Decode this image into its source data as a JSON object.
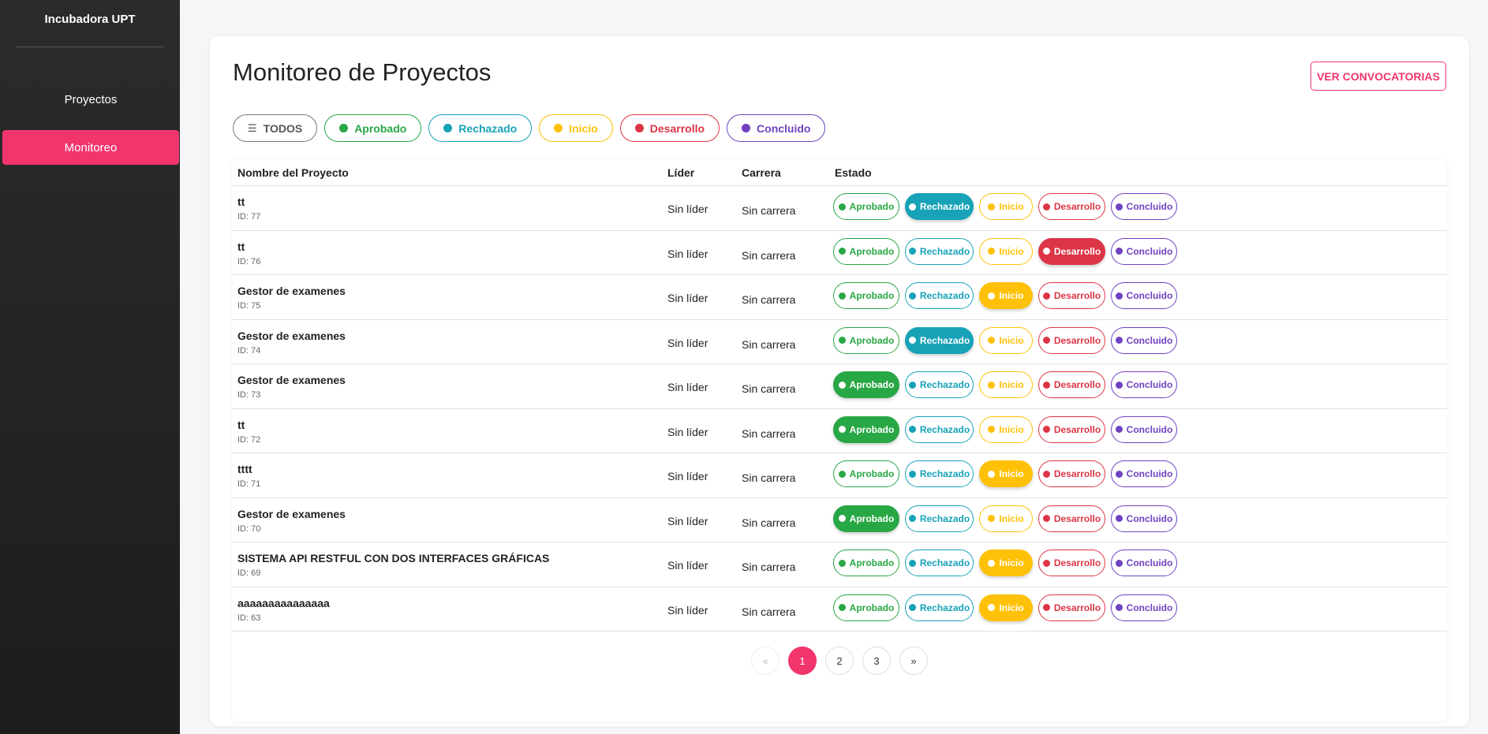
{
  "sidebar": {
    "brand": "Incubadora UPT",
    "items": [
      {
        "label": "Proyectos",
        "active": false
      },
      {
        "label": "Monitoreo",
        "active": true
      }
    ]
  },
  "header": {
    "title": "Monitoreo de Proyectos",
    "convocatorias_label": "VER CONVOCATORIAS"
  },
  "filters": [
    {
      "label": "TODOS",
      "icon": "layers-icon"
    },
    {
      "label": "Aprobado",
      "color": "#28a745"
    },
    {
      "label": "Rechazado",
      "color": "#17a2b8"
    },
    {
      "label": "Inicio",
      "color": "#ffc107"
    },
    {
      "label": "Desarrollo",
      "color": "#dc3545"
    },
    {
      "label": "Concluido",
      "color": "#6f42c1"
    }
  ],
  "table": {
    "headers": [
      "Nombre del Proyecto",
      "Líder",
      "Carrera",
      "Estado"
    ],
    "state_labels": [
      "Aprobado",
      "Rechazado",
      "Inicio",
      "Desarrollo",
      "Concluido"
    ],
    "rows": [
      {
        "name": "tt",
        "id": "ID: 77",
        "lider": "Sin líder",
        "carrera": "Sin carrera",
        "estado": "Rechazado"
      },
      {
        "name": "tt",
        "id": "ID: 76",
        "lider": "Sin líder",
        "carrera": "Sin carrera",
        "estado": "Desarrollo"
      },
      {
        "name": "Gestor de examenes",
        "id": "ID: 75",
        "lider": "Sin líder",
        "carrera": "Sin carrera",
        "estado": "Inicio"
      },
      {
        "name": "Gestor de examenes",
        "id": "ID: 74",
        "lider": "Sin líder",
        "carrera": "Sin carrera",
        "estado": "Rechazado"
      },
      {
        "name": "Gestor de examenes",
        "id": "ID: 73",
        "lider": "Sin líder",
        "carrera": "Sin carrera",
        "estado": "Aprobado"
      },
      {
        "name": "tt",
        "id": "ID: 72",
        "lider": "Sin líder",
        "carrera": "Sin carrera",
        "estado": "Aprobado"
      },
      {
        "name": "tttt",
        "id": "ID: 71",
        "lider": "Sin líder",
        "carrera": "Sin carrera",
        "estado": "Inicio"
      },
      {
        "name": "Gestor de examenes",
        "id": "ID: 70",
        "lider": "Sin líder",
        "carrera": "Sin carrera",
        "estado": "Aprobado"
      },
      {
        "name": "SISTEMA API RESTFUL CON DOS INTERFACES GRÁFICAS",
        "id": "ID: 69",
        "lider": "Sin líder",
        "carrera": "Sin carrera",
        "estado": "Inicio"
      },
      {
        "name": "aaaaaaaaaaaaaaa",
        "id": "ID: 63",
        "lider": "Sin líder",
        "carrera": "Sin carrera",
        "estado": "Inicio"
      }
    ]
  },
  "pagination": {
    "prev": "«",
    "pages": [
      "1",
      "2",
      "3"
    ],
    "current": "1",
    "next": "»"
  },
  "colors": {
    "accent": "#f2356d",
    "aprobado": "#28a745",
    "rechazado": "#17a2b8",
    "inicio": "#ffc107",
    "desarrollo": "#dc3545",
    "concluido": "#6f42c1"
  }
}
